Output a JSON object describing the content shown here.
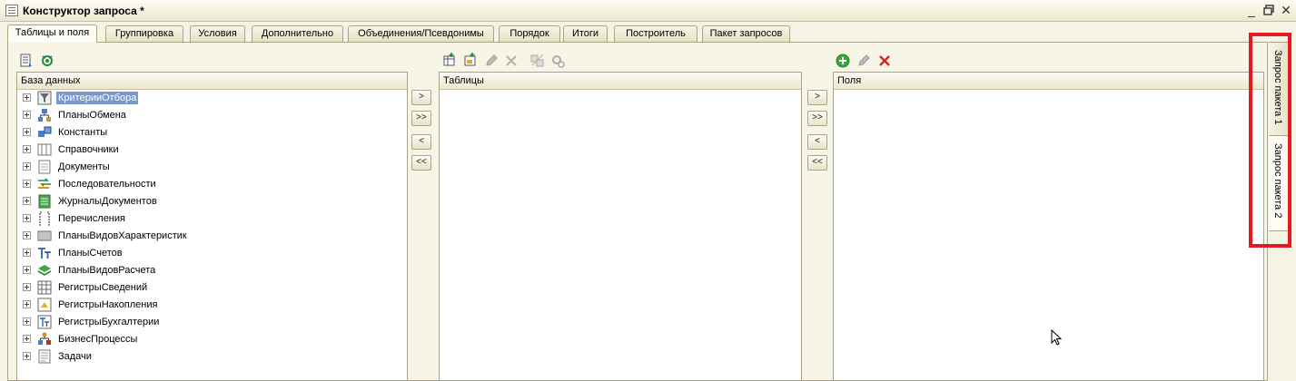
{
  "window": {
    "title": "Конструктор запроса *"
  },
  "tabs": [
    {
      "label": "Таблицы и поля",
      "active": true
    },
    {
      "label": "Группировка"
    },
    {
      "label": "Условия"
    },
    {
      "label": "Дополнительно"
    },
    {
      "label": "Объединения/Псевдонимы"
    },
    {
      "label": "Порядок"
    },
    {
      "label": "Итоги"
    },
    {
      "label": "Построитель"
    },
    {
      "label": "Пакет запросов"
    }
  ],
  "panels": {
    "database": {
      "header": "База данных",
      "items": [
        {
          "label": "КритерииОтбора",
          "icon": "filter-criteria-icon",
          "selected": true
        },
        {
          "label": "ПланыОбмена",
          "icon": "exchange-plans-icon"
        },
        {
          "label": "Константы",
          "icon": "constants-icon"
        },
        {
          "label": "Справочники",
          "icon": "catalogs-icon"
        },
        {
          "label": "Документы",
          "icon": "documents-icon"
        },
        {
          "label": "Последовательности",
          "icon": "sequences-icon"
        },
        {
          "label": "ЖурналыДокументов",
          "icon": "document-journals-icon"
        },
        {
          "label": "Перечисления",
          "icon": "enums-icon"
        },
        {
          "label": "ПланыВидовХарактеристик",
          "icon": "characteristic-types-icon"
        },
        {
          "label": "ПланыСчетов",
          "icon": "chart-of-accounts-icon"
        },
        {
          "label": "ПланыВидовРасчета",
          "icon": "calculation-types-icon"
        },
        {
          "label": "РегистрыСведений",
          "icon": "information-registers-icon"
        },
        {
          "label": "РегистрыНакопления",
          "icon": "accumulation-registers-icon"
        },
        {
          "label": "РегистрыБухгалтерии",
          "icon": "accounting-registers-icon"
        },
        {
          "label": "БизнесПроцессы",
          "icon": "business-processes-icon"
        },
        {
          "label": "Задачи",
          "icon": "tasks-icon"
        }
      ]
    },
    "tables": {
      "header": "Таблицы"
    },
    "fields": {
      "header": "Поля"
    }
  },
  "transfer_buttons": {
    "add": ">",
    "add_all": ">>",
    "remove": "<",
    "remove_all": "<<"
  },
  "side_tabs": [
    {
      "label": "Запрос пакета 1"
    },
    {
      "label": "Запрос пакета 2",
      "active": true
    }
  ],
  "colors": {
    "highlight": "#e21a22",
    "selection": "#7a99c9"
  }
}
